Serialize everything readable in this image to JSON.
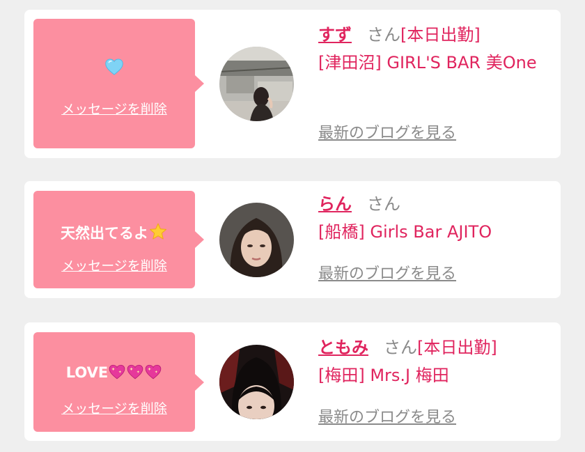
{
  "cards": [
    {
      "message_text": "",
      "message_icon": "light-blue-heart-icon",
      "delete_label": "メッセージを削除",
      "name": "すず",
      "honorific": "さん",
      "status": "[本日出勤]",
      "shop": "[津田沼] GIRL'S BAR 美One",
      "blog_link": "最新のブログを見る"
    },
    {
      "message_text": "天然出てるよ",
      "message_icon": "star-icon",
      "delete_label": "メッセージを削除",
      "name": "らん",
      "honorific": "さん",
      "status": "",
      "shop": "[船橋] Girls Bar AJITO",
      "blog_link": "最新のブログを見る"
    },
    {
      "message_text": "LOVE",
      "message_icon": "sparkling-heart-icon",
      "delete_label": "メッセージを削除",
      "name": "ともみ",
      "honorific": "さん",
      "status": "[本日出勤]",
      "shop": "[梅田] Mrs.J 梅田",
      "blog_link": "最新のブログを見る"
    }
  ],
  "colors": {
    "background": "#efefef",
    "card": "#ffffff",
    "bubble": "#fc8fa0",
    "accent": "#e0245e",
    "muted": "#8a8a8a"
  }
}
